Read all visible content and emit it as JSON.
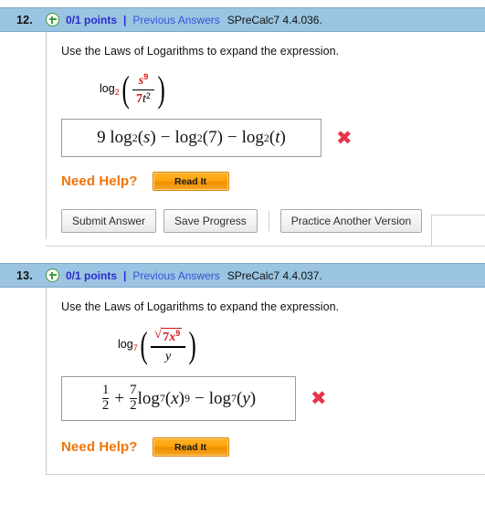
{
  "problems": [
    {
      "number": "12.",
      "points": "0/1 points",
      "separator": "|",
      "previous_answers": "Previous Answers",
      "code": "SPreCalc7 4.4.036.",
      "prompt": "Use the Laws of Logarithms to expand the expression.",
      "question_math": {
        "log_text": "log",
        "log_base": "2",
        "numerator_var": "s",
        "numerator_exp": "9",
        "denominator_coef": "7",
        "denominator_var": "t",
        "denominator_exp": "2"
      },
      "answer": {
        "coefficient": "9",
        "log_text": "log",
        "base": "2",
        "terms": [
          "s",
          "7",
          "t"
        ],
        "op1": "−",
        "op2": "−",
        "full_text": "9 log2(s) − log2(7) − log2(t)"
      },
      "answer_status_icon": "wrong-x-icon",
      "need_help_label": "Need Help?",
      "read_it_label": "Read It",
      "buttons": [
        "Submit Answer",
        "Save Progress",
        "Practice Another Version"
      ],
      "has_actions": true
    },
    {
      "number": "13.",
      "points": "0/1 points",
      "separator": "|",
      "previous_answers": "Previous Answers",
      "code": "SPreCalc7 4.4.037.",
      "prompt": "Use the Laws of Logarithms to expand the expression.",
      "question_math": {
        "log_text": "log",
        "log_base": "7",
        "radicand_coef": "7",
        "radicand_var": "x",
        "radicand_exp": "9",
        "denominator_var": "y"
      },
      "answer": {
        "frac1_num": "1",
        "frac1_den": "2",
        "plus": "+",
        "frac2_num": "7",
        "frac2_den": "2",
        "log_text": "log",
        "base": "7",
        "var1": "x",
        "exp1": "9",
        "op2": "−",
        "var2": "y",
        "full_text": "1/2 + 7/2 log7(x)^9 − log7(y)"
      },
      "answer_status_icon": "wrong-x-icon",
      "need_help_label": "Need Help?",
      "read_it_label": "Read It",
      "buttons": [],
      "has_actions": false
    }
  ],
  "colors": {
    "header_blue": "#9ac4e2",
    "points_blue": "#2b2bd0",
    "link_blue": "#3b52d6",
    "orange": "#f27405",
    "red_x": "#e8334a",
    "math_red": "#d81414"
  }
}
